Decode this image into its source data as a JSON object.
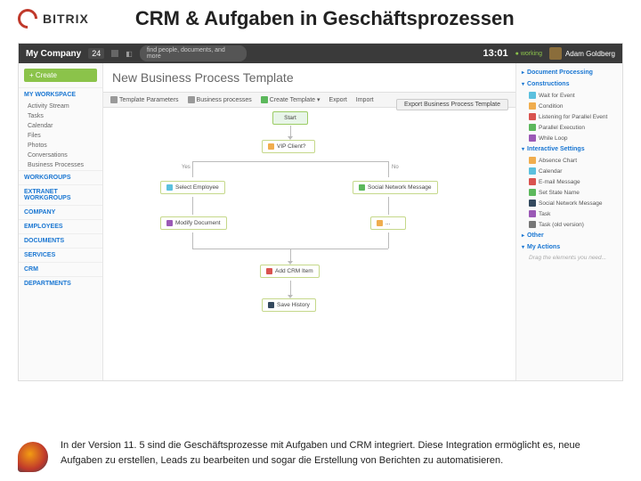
{
  "slide": {
    "brand": "BITRIX",
    "title": "CRM & Aufgaben in Geschäftsprozessen"
  },
  "topbar": {
    "company": "My Company",
    "badge": "24",
    "search_placeholder": "find people, documents, and more",
    "time": "13:01",
    "status": "working",
    "user": "Adam Goldberg"
  },
  "sidebar": {
    "create": "+ Create",
    "sections": [
      {
        "label": "MY WORKSPACE",
        "items": [
          "Activity Stream",
          "Tasks",
          "Calendar",
          "Files",
          "Photos",
          "Conversations",
          "Business Processes"
        ]
      },
      {
        "label": "WORKGROUPS",
        "items": []
      },
      {
        "label": "EXTRANET WORKGROUPS",
        "items": []
      },
      {
        "label": "COMPANY",
        "items": []
      },
      {
        "label": "EMPLOYEES",
        "items": []
      },
      {
        "label": "DOCUMENTS",
        "items": []
      },
      {
        "label": "SERVICES",
        "items": []
      },
      {
        "label": "CRM",
        "items": []
      },
      {
        "label": "DEPARTMENTS",
        "items": []
      }
    ]
  },
  "page": {
    "title": "New Business Process Template",
    "toolbar": {
      "params": "Template Parameters",
      "processes": "Business processes",
      "create": "Create Template",
      "export": "Export",
      "import": "Import"
    },
    "save": "Export Business Process Template"
  },
  "flow": {
    "start": "Start",
    "n1": "VIP Client?",
    "yes": "Yes",
    "no": "No",
    "n2": "Select Employee",
    "n3": "Social Network Message",
    "n4": "Modify Document",
    "n5": "...",
    "n6": "Add CRM Item",
    "n7": "Save History"
  },
  "palette": {
    "s1": "Document Processing",
    "s2": "Constructions",
    "c_items": [
      "Wait for Event",
      "Condition",
      "Listening for Parallel Event",
      "Parallel Execution",
      "While Loop"
    ],
    "s3": "Interactive Settings",
    "i_items": [
      "Absence Chart",
      "Calendar",
      "E-mail Message",
      "Set State Name",
      "Social Network Message",
      "Task",
      "Task (old version)"
    ],
    "s4": "Other",
    "s5": "My Actions",
    "drag": "Drag the elements you need..."
  },
  "footer": {
    "text": "In der Version 11. 5 sind die Geschäftsprozesse mit Aufgaben und CRM integriert. Diese Integration ermöglicht es, neue Aufgaben zu erstellen, Leads zu bearbeiten und sogar die Erstellung von Berichten zu automatisieren."
  },
  "colors": {
    "c1": "#f0ad4e",
    "c2": "#5bc0de",
    "c3": "#d9534f",
    "c4": "#5cb85c",
    "c5": "#9b59b6",
    "c6": "#34495e"
  }
}
